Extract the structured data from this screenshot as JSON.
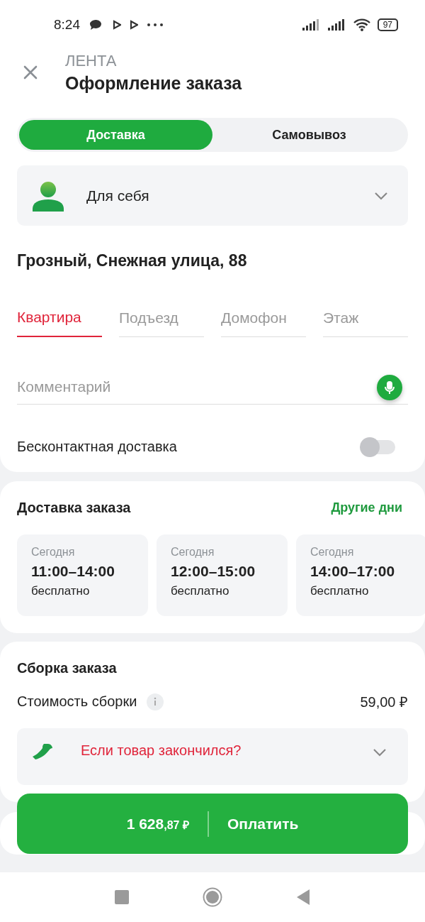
{
  "status_bar": {
    "time": "8:24",
    "battery": "97"
  },
  "header": {
    "brand": "ЛЕНТА",
    "title": "Оформление заказа"
  },
  "tabs": [
    {
      "label": "Доставка",
      "selected": true
    },
    {
      "label": "Самовывоз",
      "selected": false
    }
  ],
  "recipient": {
    "label": "Для себя"
  },
  "address": "Грозный, Снежная улица, 88",
  "address_fields": [
    {
      "placeholder": "Квартира",
      "selected": true
    },
    {
      "placeholder": "Подъезд",
      "selected": false
    },
    {
      "placeholder": "Домофон",
      "selected": false
    },
    {
      "placeholder": "Этаж",
      "selected": false
    }
  ],
  "comment": {
    "placeholder": "Комментарий"
  },
  "contactless": {
    "label": "Бесконтактная доставка",
    "on": false
  },
  "delivery": {
    "title": "Доставка заказа",
    "link": "Другие дни",
    "slots": [
      {
        "day": "Сегодня",
        "time": "11:00–14:00",
        "price": "бесплатно",
        "selected": false
      },
      {
        "day": "Сегодня",
        "time": "12:00–15:00",
        "price": "бесплатно",
        "selected": false
      },
      {
        "day": "Сегодня",
        "time": "14:00–17:00",
        "price": "бесплатно",
        "selected": false
      }
    ]
  },
  "assembly": {
    "title": "Сборка заказа",
    "cost_label": "Стоимость сборки",
    "cost": "59,00 ₽",
    "dropdown": "Если товар закончился?"
  },
  "pay_button": {
    "amount": "1 628",
    "amount_fraction": ",87 ₽",
    "label": "Оплатить"
  }
}
